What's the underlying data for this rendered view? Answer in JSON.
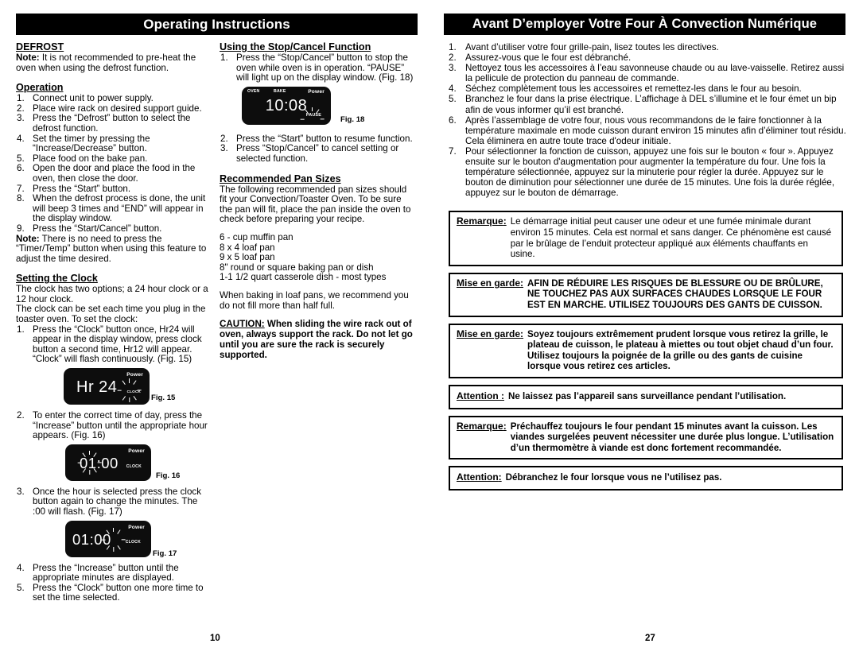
{
  "left_page": {
    "banner": "Operating Instructions",
    "page_number": "10",
    "col1": {
      "defrost_heading": "DEFROST",
      "defrost_note": "Note: It is not recommended to pre-heat the oven when using the defrost function.",
      "defrost_note_lead": "Note:",
      "defrost_note_rest": " It is not recommended to pre-heat the oven when using the defrost function.",
      "operation_heading": "Operation",
      "operation_steps": [
        "Connect unit to power supply.",
        "Place wire rack on desired support guide.",
        "Press the “Defrost” button to select the defrost function.",
        "Set the timer by pressing the “Increase/Decrease” button.",
        "Place food on the bake pan.",
        "Open the door and place the food in the oven, then close the door.",
        "Press the “Start” button.",
        "When the defrost process is done, the unit will beep 3 times and “END” will appear in the display window.",
        "Press the “Start/Cancel” button."
      ],
      "operation_note_lead": "Note:",
      "operation_note_rest": " There is no need to press the “Timer/Temp” button when using this feature to adjust the time desired.",
      "clock_heading": "Setting the Clock",
      "clock_para1": "The clock has two options; a 24 hour clock or a 12 hour clock.",
      "clock_para2": "The clock can be set each time you plug in the toaster oven. To set the clock:",
      "clock_step1": "Press the “Clock” button once, Hr24 will appear in the display window, press clock button a second time, Hr12 will appear.  “Clock” will flash continuously. (Fig. 15)",
      "clock_step2": "To enter the correct time of day, press the “Increase” button until the appropriate hour appears. (Fig. 16)",
      "clock_step3": "Once the hour is selected press the clock button again to change the minutes. The :00 will flash. (Fig. 17)",
      "clock_step4": "Press the “Increase” button until the appropriate minutes are displayed.",
      "clock_step5": "Press the “Clock” button one more time to set the time selected."
    },
    "col2": {
      "stopcancel_heading": "Using the Stop/Cancel Function",
      "stopcancel_step1": "Press the “Stop/Cancel” button to stop the oven while oven is in operation. “PAUSE” will light up on the display window. (Fig. 18)",
      "stopcancel_step2": "Press the “Start” button to resume function.",
      "stopcancel_step3": "Press “Stop/Cancel” to cancel setting or selected function.",
      "pansizes_heading": "Recommended Pan Sizes",
      "pansizes_intro": "The following recommended pan sizes should fit your Convection/Toaster Oven. To be sure the pan will fit, place the pan inside the oven to check before preparing your recipe.",
      "pansizes_list": [
        "6 - cup muffin pan",
        "8 x 4 loaf pan",
        "9 x 5 loaf pan",
        "8\"  round or square baking pan or dish",
        "1-1 1/2 quart casserole dish - most types"
      ],
      "loaf_note": "When baking in loaf pans, we recommend you do not fill more than half full.",
      "caution_lead": "CAUTION:",
      "caution_rest": "  When sliding the wire rack out of oven, always support the rack.  Do not let go until you are sure the rack is securely supported."
    },
    "figures": {
      "fig15": {
        "caption": "Fig. 15",
        "digits": "Hr 24",
        "label_power": "Power",
        "label_clock": "CLOCK"
      },
      "fig16": {
        "caption": "Fig. 16",
        "digits": "01:00",
        "label_power": "Power",
        "label_clock": "CLOCK"
      },
      "fig17": {
        "caption": "Fig. 17",
        "digits": "01:00",
        "label_power": "Power",
        "label_clock": "CLOCK"
      },
      "fig18": {
        "caption": "Fig. 18",
        "digits": "10:08",
        "label_oven": "OVEN",
        "label_bake": "BAKE",
        "label_power": "Power",
        "label_pause": "PAUSE"
      }
    }
  },
  "right_page": {
    "banner": "Avant D’employer Votre Four À Convection Numérique",
    "page_number": "27",
    "steps": [
      "Avant d’utiliser votre four grille-pain, lisez toutes les directives.",
      "Assurez-vous que le four est débranché.",
      "Nettoyez tous les accessoires à l’eau savonneuse chaude ou au lave-vaisselle. Retirez aussi la pellicule de protection du panneau de commande.",
      "Séchez complètement tous les accessoires et remettez-les dans le four au besoin.",
      "Branchez le four dans la prise électrique. L’affichage à DEL s’illumine et le four émet un bip afin de vous informer qu’il est branché.",
      "Après l’assemblage de votre four, nous vous recommandons de le faire fonctionner à la température maximale en mode cuisson durant environ 15 minutes afin d’éliminer tout résidu. Cela éliminera en autre toute trace d'odeur initiale.",
      "Pour sélectionner la fonction de cuisson, appuyez une fois sur le bouton « four ». Appuyez ensuite sur le bouton d'augmentation pour augmenter la température du four.  Une fois la température sélectionnée, appuyez sur la minuterie pour régler la durée.  Appuyez sur le bouton de diminution pour sélectionner une durée de 15 minutes.  Une fois la durée réglée, appuyez sur le bouton de démarrage."
    ],
    "boxes": [
      {
        "lead": "Remarque",
        "colon": ":",
        "body": "Le démarrage initial peut causer une odeur et une fumée minimale durant environ 15 minutes.  Cela est normal et sans danger.  Ce phénomène est causé par le brûlage de l’enduit protecteur appliqué aux éléments chauffants en usine.",
        "style": "normal"
      },
      {
        "lead": "Mise en garde",
        "colon": ":",
        "body": "AFIN DE RÉDUIRE LES RISQUES DE BLESSURE OU DE BRÛLURE, NE TOUCHEZ PAS AUX SURFACES CHAUDES LORSQUE LE FOUR EST EN MARCHE.  UTILISEZ TOUJOURS DES GANTS DE CUISSON.",
        "style": "bold"
      },
      {
        "lead": "Mise en garde",
        "colon": ":",
        "body": "Soyez toujours extrêmement prudent lorsque vous retirez la grille, le plateau de cuisson, le plateau à miettes ou tout objet chaud d’un four. Utilisez toujours la poignée de la grille ou des gants de cuisine lorsque vous retirez ces articles.",
        "style": "bold"
      },
      {
        "lead": "Attention ",
        "colon": ":",
        "body": "Ne laissez pas l’appareil sans surveillance pendant l’utilisation.",
        "style": "bold-one-line"
      },
      {
        "lead": "Remarque",
        "colon": ":",
        "body": "Préchauffez toujours le four pendant 15 minutes avant la cuisson. Les viandes surgelées peuvent nécessiter une durée plus longue.  L’utilisation d’un thermomètre à viande est donc fortement recommandée.",
        "style": "bold"
      },
      {
        "lead": "Attention",
        "colon": ":",
        "body": "Débranchez le four lorsque vous ne l’utilisez pas.",
        "style": "bold-one-line"
      }
    ]
  }
}
